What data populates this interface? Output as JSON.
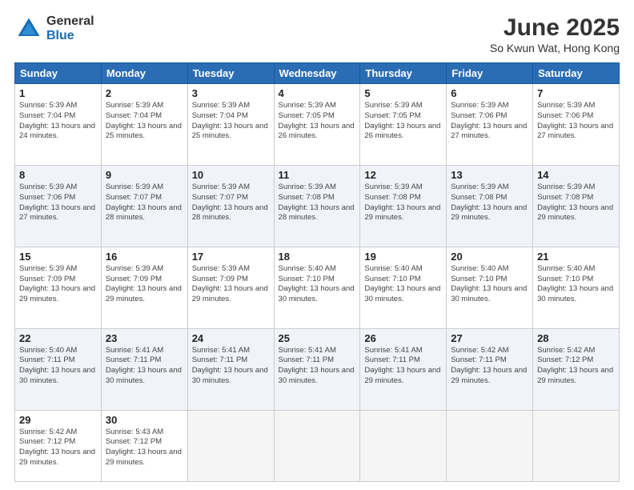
{
  "logo": {
    "general": "General",
    "blue": "Blue"
  },
  "title": "June 2025",
  "location": "So Kwun Wat, Hong Kong",
  "days_header": [
    "Sunday",
    "Monday",
    "Tuesday",
    "Wednesday",
    "Thursday",
    "Friday",
    "Saturday"
  ],
  "weeks": [
    [
      {
        "day": "1",
        "sunrise": "5:39 AM",
        "sunset": "7:04 PM",
        "daylight": "13 hours and 24 minutes."
      },
      {
        "day": "2",
        "sunrise": "5:39 AM",
        "sunset": "7:04 PM",
        "daylight": "13 hours and 25 minutes."
      },
      {
        "day": "3",
        "sunrise": "5:39 AM",
        "sunset": "7:04 PM",
        "daylight": "13 hours and 25 minutes."
      },
      {
        "day": "4",
        "sunrise": "5:39 AM",
        "sunset": "7:05 PM",
        "daylight": "13 hours and 26 minutes."
      },
      {
        "day": "5",
        "sunrise": "5:39 AM",
        "sunset": "7:05 PM",
        "daylight": "13 hours and 26 minutes."
      },
      {
        "day": "6",
        "sunrise": "5:39 AM",
        "sunset": "7:06 PM",
        "daylight": "13 hours and 27 minutes."
      },
      {
        "day": "7",
        "sunrise": "5:39 AM",
        "sunset": "7:06 PM",
        "daylight": "13 hours and 27 minutes."
      }
    ],
    [
      {
        "day": "8",
        "sunrise": "5:39 AM",
        "sunset": "7:06 PM",
        "daylight": "13 hours and 27 minutes."
      },
      {
        "day": "9",
        "sunrise": "5:39 AM",
        "sunset": "7:07 PM",
        "daylight": "13 hours and 28 minutes."
      },
      {
        "day": "10",
        "sunrise": "5:39 AM",
        "sunset": "7:07 PM",
        "daylight": "13 hours and 28 minutes."
      },
      {
        "day": "11",
        "sunrise": "5:39 AM",
        "sunset": "7:08 PM",
        "daylight": "13 hours and 28 minutes."
      },
      {
        "day": "12",
        "sunrise": "5:39 AM",
        "sunset": "7:08 PM",
        "daylight": "13 hours and 29 minutes."
      },
      {
        "day": "13",
        "sunrise": "5:39 AM",
        "sunset": "7:08 PM",
        "daylight": "13 hours and 29 minutes."
      },
      {
        "day": "14",
        "sunrise": "5:39 AM",
        "sunset": "7:08 PM",
        "daylight": "13 hours and 29 minutes."
      }
    ],
    [
      {
        "day": "15",
        "sunrise": "5:39 AM",
        "sunset": "7:09 PM",
        "daylight": "13 hours and 29 minutes."
      },
      {
        "day": "16",
        "sunrise": "5:39 AM",
        "sunset": "7:09 PM",
        "daylight": "13 hours and 29 minutes."
      },
      {
        "day": "17",
        "sunrise": "5:39 AM",
        "sunset": "7:09 PM",
        "daylight": "13 hours and 29 minutes."
      },
      {
        "day": "18",
        "sunrise": "5:40 AM",
        "sunset": "7:10 PM",
        "daylight": "13 hours and 30 minutes."
      },
      {
        "day": "19",
        "sunrise": "5:40 AM",
        "sunset": "7:10 PM",
        "daylight": "13 hours and 30 minutes."
      },
      {
        "day": "20",
        "sunrise": "5:40 AM",
        "sunset": "7:10 PM",
        "daylight": "13 hours and 30 minutes."
      },
      {
        "day": "21",
        "sunrise": "5:40 AM",
        "sunset": "7:10 PM",
        "daylight": "13 hours and 30 minutes."
      }
    ],
    [
      {
        "day": "22",
        "sunrise": "5:40 AM",
        "sunset": "7:11 PM",
        "daylight": "13 hours and 30 minutes."
      },
      {
        "day": "23",
        "sunrise": "5:41 AM",
        "sunset": "7:11 PM",
        "daylight": "13 hours and 30 minutes."
      },
      {
        "day": "24",
        "sunrise": "5:41 AM",
        "sunset": "7:11 PM",
        "daylight": "13 hours and 30 minutes."
      },
      {
        "day": "25",
        "sunrise": "5:41 AM",
        "sunset": "7:11 PM",
        "daylight": "13 hours and 30 minutes."
      },
      {
        "day": "26",
        "sunrise": "5:41 AM",
        "sunset": "7:11 PM",
        "daylight": "13 hours and 29 minutes."
      },
      {
        "day": "27",
        "sunrise": "5:42 AM",
        "sunset": "7:11 PM",
        "daylight": "13 hours and 29 minutes."
      },
      {
        "day": "28",
        "sunrise": "5:42 AM",
        "sunset": "7:12 PM",
        "daylight": "13 hours and 29 minutes."
      }
    ],
    [
      {
        "day": "29",
        "sunrise": "5:42 AM",
        "sunset": "7:12 PM",
        "daylight": "13 hours and 29 minutes."
      },
      {
        "day": "30",
        "sunrise": "5:43 AM",
        "sunset": "7:12 PM",
        "daylight": "13 hours and 29 minutes."
      },
      null,
      null,
      null,
      null,
      null
    ]
  ]
}
